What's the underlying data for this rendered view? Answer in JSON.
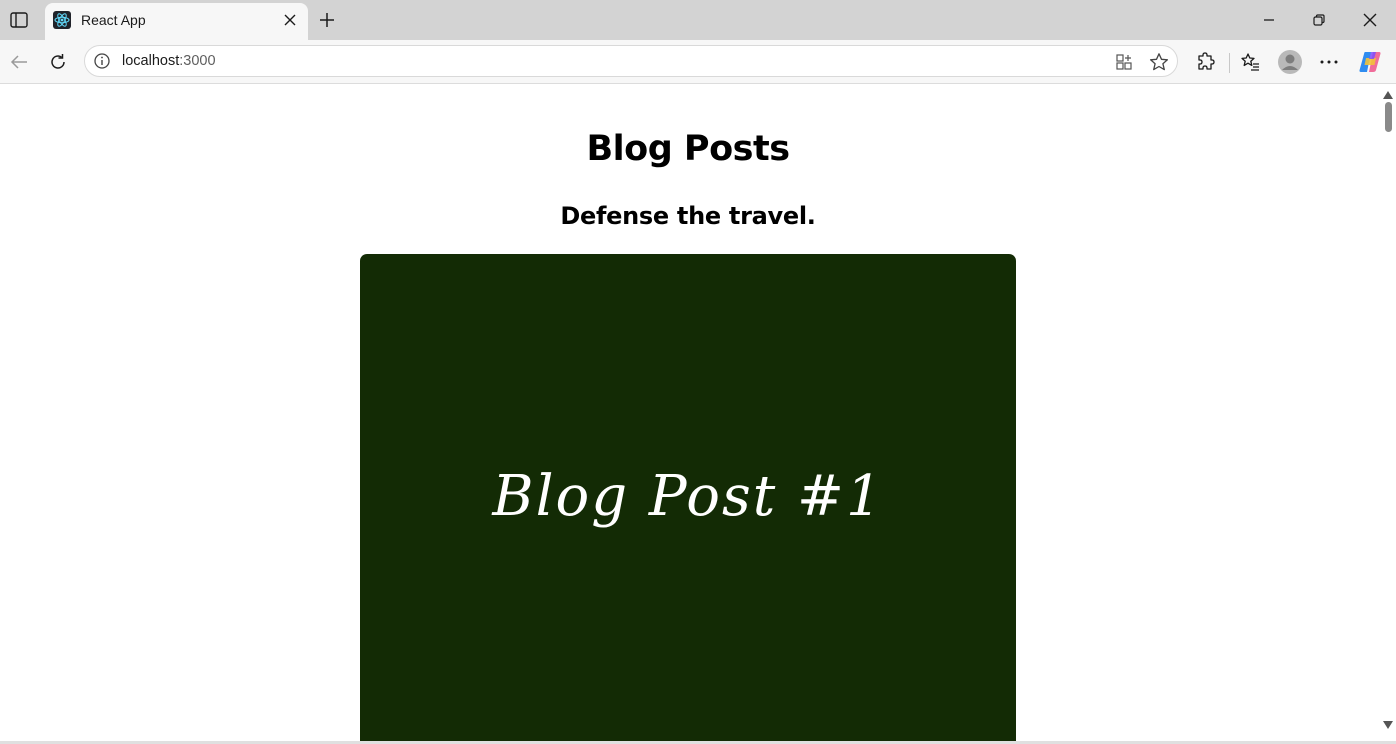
{
  "browser": {
    "tab": {
      "title": "React App"
    },
    "address_bar": {
      "host": "localhost",
      "port": ":3000"
    }
  },
  "page": {
    "heading": "Blog Posts",
    "post": {
      "title": "Defense the travel.",
      "image_text": "Blog Post #1"
    }
  },
  "colors": {
    "post_image_bg": "#132b05",
    "react_logo": "#61dafb"
  }
}
